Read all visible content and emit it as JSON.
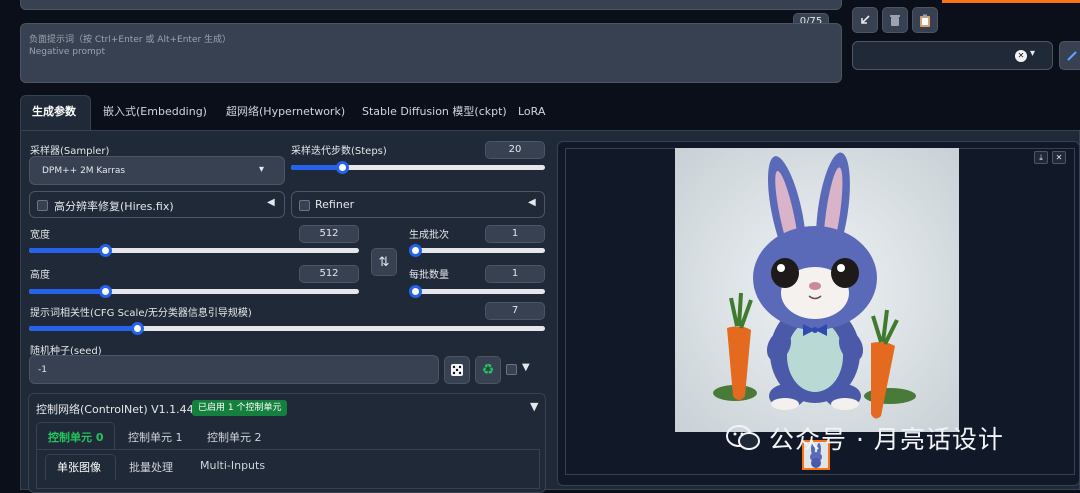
{
  "prompt": {
    "counter": "0/75",
    "negative_placeholder_cn": "负面提示词（按 Ctrl+Enter 或 Alt+Enter 生成）",
    "negative_placeholder_en": "Negative prompt"
  },
  "main_tabs": [
    "生成参数",
    "嵌入式(Embedding)",
    "超网络(Hypernetwork)",
    "Stable Diffusion 模型(ckpt)",
    "LoRA"
  ],
  "sampler": {
    "label": "采样器(Sampler)",
    "value": "DPM++ 2M Karras"
  },
  "steps": {
    "label": "采样迭代步数(Steps)",
    "value": "20",
    "fraction": 0.2
  },
  "hires": {
    "label": "高分辨率修复(Hires.fix)",
    "arrow": "◀"
  },
  "refiner": {
    "label": "Refiner",
    "arrow": "◀"
  },
  "width": {
    "label": "宽度",
    "value": "512",
    "fraction": 0.23
  },
  "height": {
    "label": "高度",
    "value": "512",
    "fraction": 0.23
  },
  "batch_count": {
    "label": "生成批次",
    "value": "1",
    "fraction": 0.0
  },
  "batch_size": {
    "label": "每批数量",
    "value": "1",
    "fraction": 0.0
  },
  "cfg": {
    "label": "提示词相关性(CFG Scale/无分类器信息引导规模)",
    "value": "7",
    "fraction": 0.21
  },
  "seed": {
    "label": "随机种子(seed)",
    "value": "-1",
    "arrow": "▼"
  },
  "controlnet": {
    "title": "控制网络(ControlNet) V1.1.440",
    "badge": "已启用 1 个控制单元",
    "arrow": "▼",
    "units": [
      "控制单元 0",
      "控制单元 1",
      "控制单元 2"
    ],
    "subtabs": [
      "单张图像",
      "批量处理",
      "Multi-Inputs"
    ]
  },
  "watermark": "公众号 · 月亮话设计",
  "icons": {
    "swap": "⇅",
    "dice": "🎲",
    "recycle": "♻",
    "dropdown": "▾",
    "clear": "✕",
    "download": "⤓",
    "close": "✕"
  },
  "colors": {
    "accent": "#2563eb",
    "badge": "#15803d",
    "orange": "#f97316"
  }
}
